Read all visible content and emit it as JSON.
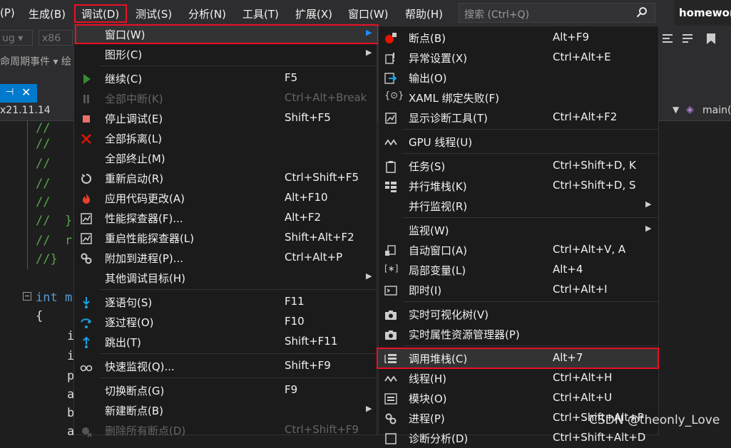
{
  "menubar": {
    "items": [
      "(P)",
      "生成(B)",
      "调试(D)",
      "测试(S)",
      "分析(N)",
      "工具(T)",
      "扩展(X)",
      "窗口(W)",
      "帮助(H)"
    ],
    "search_placeholder": "搜索 (Ctrl+Q)",
    "project": "homework"
  },
  "toolbar": {
    "config": "ug",
    "platform": "x86"
  },
  "breadcrumb": {
    "text": "命周期事件  ▾  绘"
  },
  "navbar": {
    "left": "x21.11.14",
    "right": "main("
  },
  "code": [
    "//   {",
    "//",
    "//",
    "//",
    "//",
    "//  }",
    "//  r",
    "//}",
    "int m",
    "{",
    "i",
    "i",
    "p",
    "a",
    "b",
    "a"
  ],
  "debug_menu": {
    "items": [
      {
        "label": "窗口(W)",
        "key": "",
        "icon": "none",
        "submenu": true
      },
      {
        "label": "图形(C)",
        "key": "",
        "icon": "none",
        "submenu": true
      },
      {
        "label": "继续(C)",
        "key": "F5",
        "icon": "play-icon"
      },
      {
        "label": "全部中断(K)",
        "key": "Ctrl+Alt+Break",
        "icon": "pause-icon",
        "disabled": true
      },
      {
        "label": "停止调试(E)",
        "key": "Shift+F5",
        "icon": "stop-icon"
      },
      {
        "label": "全部拆离(L)",
        "key": "",
        "icon": "detach-icon"
      },
      {
        "label": "全部终止(M)",
        "key": "",
        "icon": "none"
      },
      {
        "label": "重新启动(R)",
        "key": "Ctrl+Shift+F5",
        "icon": "restart-icon"
      },
      {
        "label": "应用代码更改(A)",
        "key": "Alt+F10",
        "icon": "hot-reload-icon"
      },
      {
        "label": "性能探查器(F)...",
        "key": "Alt+F2",
        "icon": "profiler-icon"
      },
      {
        "label": "重启性能探查器(L)",
        "key": "Shift+Alt+F2",
        "icon": "profiler-icon"
      },
      {
        "label": "附加到进程(P)...",
        "key": "Ctrl+Alt+P",
        "icon": "attach-icon"
      },
      {
        "label": "其他调试目标(H)",
        "key": "",
        "icon": "none",
        "submenu": true
      },
      {
        "label": "逐语句(S)",
        "key": "F11",
        "icon": "step-into-icon"
      },
      {
        "label": "逐过程(O)",
        "key": "F10",
        "icon": "step-over-icon"
      },
      {
        "label": "跳出(T)",
        "key": "Shift+F11",
        "icon": "step-out-icon"
      },
      {
        "label": "快速监视(Q)...",
        "key": "Shift+F9",
        "icon": "quickwatch-icon"
      },
      {
        "label": "切换断点(G)",
        "key": "F9",
        "icon": "none"
      },
      {
        "label": "新建断点(B)",
        "key": "",
        "icon": "none",
        "submenu": true
      },
      {
        "label": "删除所有断点(D)",
        "key": "Ctrl+Shift+F9",
        "icon": "delete-breakpoints-icon",
        "disabled": true
      }
    ]
  },
  "window_menu": {
    "items": [
      {
        "label": "断点(B)",
        "key": "Alt+F9",
        "icon": "breakpoint-icon"
      },
      {
        "label": "异常设置(X)",
        "key": "Ctrl+Alt+E",
        "icon": "exception-icon"
      },
      {
        "label": "输出(O)",
        "key": "",
        "icon": "output-icon"
      },
      {
        "label": "XAML 绑定失败(F)",
        "key": "",
        "icon": "xaml-icon"
      },
      {
        "label": "显示诊断工具(T)",
        "key": "Ctrl+Alt+F2",
        "icon": "diagnostics-icon"
      },
      {
        "label": "GPU 线程(U)",
        "key": "",
        "icon": "gpu-threads-icon"
      },
      {
        "label": "任务(S)",
        "key": "Ctrl+Shift+D, K",
        "icon": "tasks-icon"
      },
      {
        "label": "并行堆栈(K)",
        "key": "Ctrl+Shift+D, S",
        "icon": "parallel-stacks-icon"
      },
      {
        "label": "并行监视(R)",
        "key": "",
        "icon": "none",
        "submenu": true
      },
      {
        "label": "监视(W)",
        "key": "",
        "icon": "none",
        "submenu": true
      },
      {
        "label": "自动窗口(A)",
        "key": "Ctrl+Alt+V, A",
        "icon": "autos-icon"
      },
      {
        "label": "局部变量(L)",
        "key": "Alt+4",
        "icon": "locals-icon"
      },
      {
        "label": "即时(I)",
        "key": "Ctrl+Alt+I",
        "icon": "immediate-icon"
      },
      {
        "label": "实时可视化树(V)",
        "key": "",
        "icon": "camera-icon"
      },
      {
        "label": "实时属性资源管理器(P)",
        "key": "",
        "icon": "camera-icon"
      },
      {
        "label": "调用堆栈(C)",
        "key": "Alt+7",
        "icon": "callstack-icon"
      },
      {
        "label": "线程(H)",
        "key": "Ctrl+Alt+H",
        "icon": "threads-icon"
      },
      {
        "label": "模块(O)",
        "key": "Ctrl+Alt+U",
        "icon": "modules-icon"
      },
      {
        "label": "进程(P)",
        "key": "Ctrl+Shift+Alt+P",
        "icon": "processes-icon"
      },
      {
        "label": "诊断分析(D)",
        "key": "Ctrl+Shift+Alt+D",
        "icon": "analysis-icon"
      }
    ]
  },
  "watermark": "CSDN @theonly_Love",
  "colors": {
    "highlight_border": "#e81123",
    "menu_bg": "#1b1b1c",
    "accent": "#007acc"
  }
}
